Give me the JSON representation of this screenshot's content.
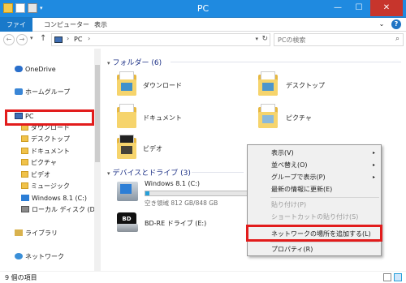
{
  "window": {
    "title": "PC"
  },
  "ribbon": {
    "tabs": [
      "ファイル",
      "コンピューター",
      "表示"
    ]
  },
  "address": {
    "crumb": "PC",
    "search_placeholder": "PCの検索"
  },
  "nav": {
    "onedrive": "OneDrive",
    "homegroup": "ホームグループ",
    "pc": "PC",
    "pc_children": [
      "ダウンロード",
      "デスクトップ",
      "ドキュメント",
      "ピクチャ",
      "ビデオ",
      "ミュージック",
      "Windows 8.1 (C:)",
      "ローカル ディスク (D:)"
    ],
    "libraries": "ライブラリ",
    "network": "ネットワーク"
  },
  "folders_group": {
    "title": "フォルダー (6)"
  },
  "folders": [
    "ダウンロード",
    "デスクトップ",
    "ドキュメント",
    "ピクチャ",
    "ビデオ"
  ],
  "drives_group": {
    "title": "デバイスとドライブ (3)"
  },
  "drives": [
    {
      "name": "Windows 8.1 (C:)",
      "free": "空き領域 812 GB/848 GB",
      "used_fraction": 0.04
    },
    {
      "name": "BD-RE ドライブ (E:)",
      "badge": "BD"
    }
  ],
  "context_menu": {
    "items": [
      {
        "label": "表示(V)",
        "arrow": "▸"
      },
      {
        "label": "並べ替え(O)",
        "arrow": "▸"
      },
      {
        "label": "グループで表示(P)",
        "arrow": "▸"
      },
      {
        "label": "最新の情報に更新(E)"
      },
      {
        "label": "貼り付け(P)"
      },
      {
        "label": "ショートカットの貼り付け(S)"
      },
      {
        "label": "ネットワークの場所を追加する(L)"
      },
      {
        "label": "プロパティ(R)"
      }
    ]
  },
  "status": {
    "count": "9 個の項目"
  },
  "colors": {
    "accent": "#1f8ae0",
    "highlight": "#e21c1c",
    "group_title": "#1e3287"
  }
}
